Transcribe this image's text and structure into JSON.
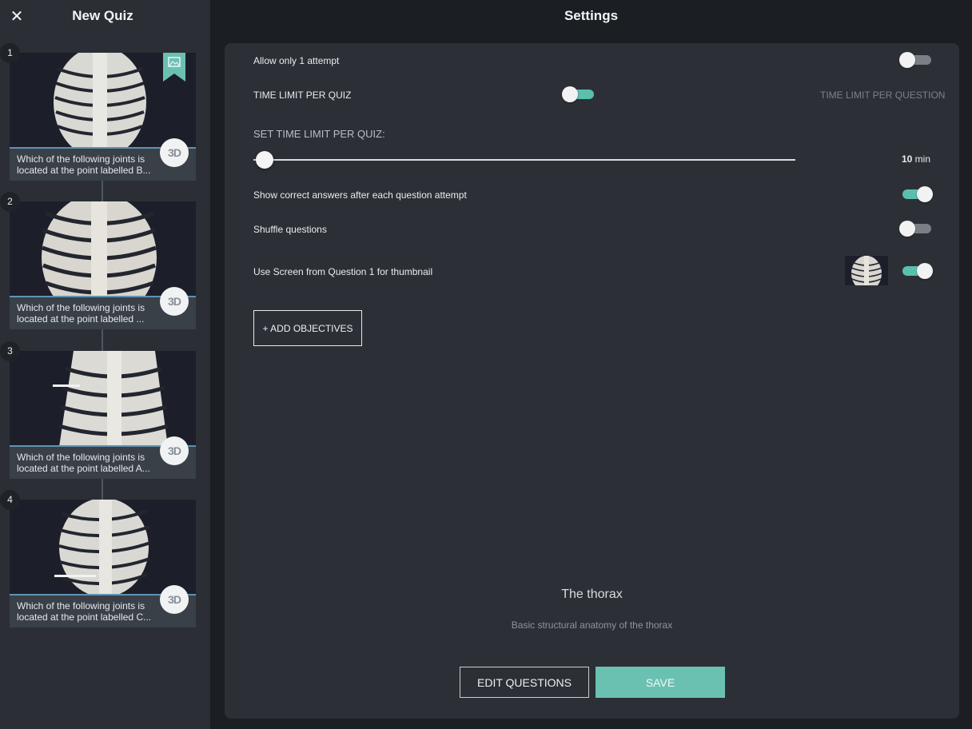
{
  "sidebar": {
    "title": "New Quiz",
    "close_icon": "✕",
    "questions": [
      {
        "number": "1",
        "line1": "Which of the following joints is",
        "line2": "located at the point labelled B...",
        "badge": "3D"
      },
      {
        "number": "2",
        "line1": "Which of the following joints is",
        "line2": "located at the point labelled ...",
        "badge": "3D"
      },
      {
        "number": "3",
        "line1": "Which of the following joints is",
        "line2": "located at the point labelled A...",
        "badge": "3D"
      },
      {
        "number": "4",
        "line1": "Which of the following joints is",
        "line2": "located at the point labelled C...",
        "badge": "3D"
      }
    ]
  },
  "main": {
    "title": "Settings",
    "settings": {
      "allow_one_attempt": {
        "label": "Allow only 1 attempt",
        "on": false
      },
      "time_limit_per_quiz": {
        "label": "TIME LIMIT PER QUIZ",
        "alt_label": "TIME LIMIT PER QUESTION",
        "selected": "per_quiz"
      },
      "set_time_limit": {
        "label": "SET TIME LIMIT PER QUIZ:",
        "value": "10",
        "unit": "min",
        "level": 0.02
      },
      "show_correct_answers": {
        "label": "Show correct answers after each question attempt",
        "on": true
      },
      "shuffle_questions": {
        "label": "Shuffle questions",
        "on": false
      },
      "use_screen_thumbnail": {
        "label": "Use Screen from Question 1 for thumbnail",
        "on": true
      }
    },
    "add_objectives_label": "+ ADD OBJECTIVES",
    "quiz_name": "The thorax",
    "quiz_description": "Basic structural anatomy of the thorax",
    "edit_questions_label": "EDIT QUESTIONS",
    "save_label": "SAVE"
  },
  "colors": {
    "accent": "#6bc1b1",
    "background": "#1b1e23",
    "panel": "#2c3036",
    "sidebar": "#2b2f35"
  }
}
